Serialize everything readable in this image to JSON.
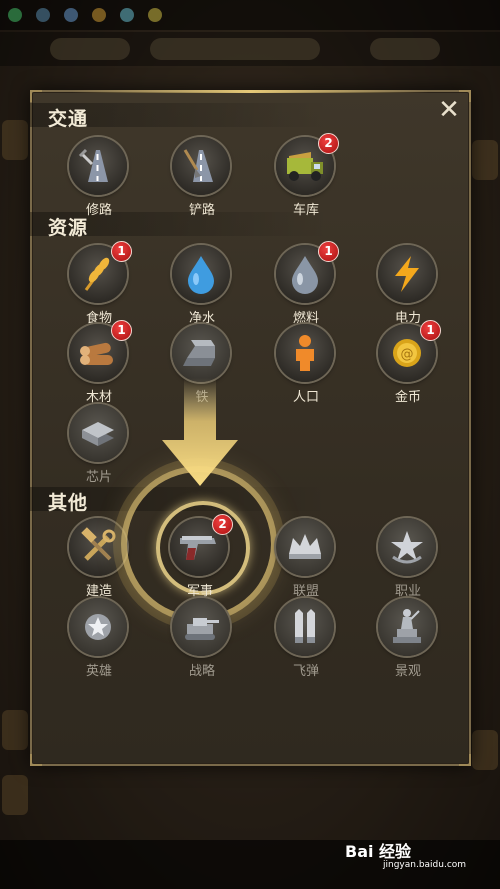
{
  "sections": {
    "traffic": "交通",
    "resources": "资源",
    "other": "其他"
  },
  "close_label": "✕",
  "traffic_items": [
    {
      "label": "修路",
      "icon": "road-repair-icon",
      "badge": ""
    },
    {
      "label": "铲路",
      "icon": "road-shovel-icon",
      "badge": ""
    },
    {
      "label": "车库",
      "icon": "garage-truck-icon",
      "badge": "2"
    }
  ],
  "resource_items": [
    {
      "label": "食物",
      "icon": "wheat-icon",
      "badge": "1"
    },
    {
      "label": "净水",
      "icon": "water-drop-icon",
      "badge": ""
    },
    {
      "label": "燃料",
      "icon": "fuel-drop-icon",
      "badge": "1"
    },
    {
      "label": "电力",
      "icon": "lightning-icon",
      "badge": ""
    },
    {
      "label": "木材",
      "icon": "wood-logs-icon",
      "badge": "1"
    },
    {
      "label": "铁",
      "icon": "iron-ingot-icon",
      "badge": ""
    },
    {
      "label": "人口",
      "icon": "person-icon",
      "badge": ""
    },
    {
      "label": "金币",
      "icon": "gold-coin-icon",
      "badge": "1"
    },
    {
      "label": "芯片",
      "icon": "chip-icon",
      "badge": ""
    }
  ],
  "other_items": [
    {
      "label": "建造",
      "icon": "build-tools-icon",
      "badge": ""
    },
    {
      "label": "军事",
      "icon": "pistol-icon",
      "badge": "2"
    },
    {
      "label": "联盟",
      "icon": "alliance-crown-icon",
      "badge": ""
    },
    {
      "label": "职业",
      "icon": "profession-star-icon",
      "badge": ""
    },
    {
      "label": "英雄",
      "icon": "hero-badge-icon",
      "badge": ""
    },
    {
      "label": "战略",
      "icon": "strategy-tank-icon",
      "badge": ""
    },
    {
      "label": "飞弹",
      "icon": "missile-icon",
      "badge": ""
    },
    {
      "label": "景观",
      "icon": "statue-icon",
      "badge": ""
    }
  ],
  "watermark": {
    "brand": "Bai 经验",
    "url": "jingyan.baidu.com"
  },
  "colors": {
    "accent": "#e6c978",
    "badge": "#d42020",
    "panel": "#3a3226"
  }
}
